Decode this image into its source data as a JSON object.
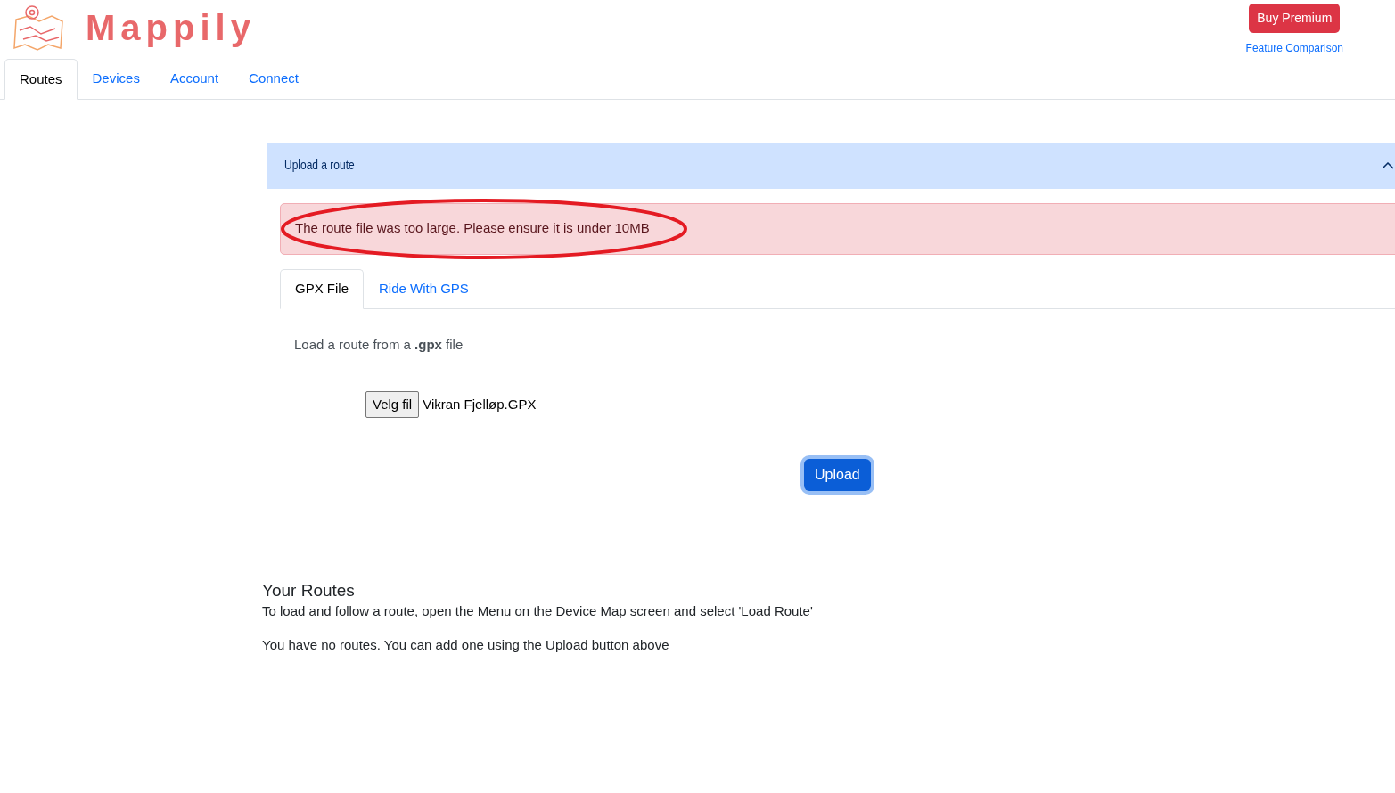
{
  "brand": {
    "name": "Mappily"
  },
  "header": {
    "premium_button": "Buy Premium",
    "comparison_link": "Feature Comparison"
  },
  "nav_tabs": [
    {
      "label": "Routes",
      "selected": true
    },
    {
      "label": "Devices",
      "selected": false
    },
    {
      "label": "Account",
      "selected": false
    },
    {
      "label": "Connect",
      "selected": false
    }
  ],
  "upload_panel": {
    "title": "Upload a route",
    "expanded": true,
    "error": "The route file was too large. Please ensure it is under 10MB",
    "tabs": [
      {
        "label": "GPX File",
        "selected": true
      },
      {
        "label": "Ride With GPS",
        "selected": false
      }
    ],
    "instruction": "Load a route from a **.gpx** file",
    "file_input": {
      "button": "Velg fil",
      "value": "Vikran Fjelløp.GPX"
    },
    "upload_button": "Upload"
  },
  "routes": {
    "title": "Your Routes",
    "hint": "To load and follow a route, open the Menu on the Device Map screen and select 'Load Route'",
    "empty_message": "You have no routes. You can add one using the Upload button above"
  }
}
